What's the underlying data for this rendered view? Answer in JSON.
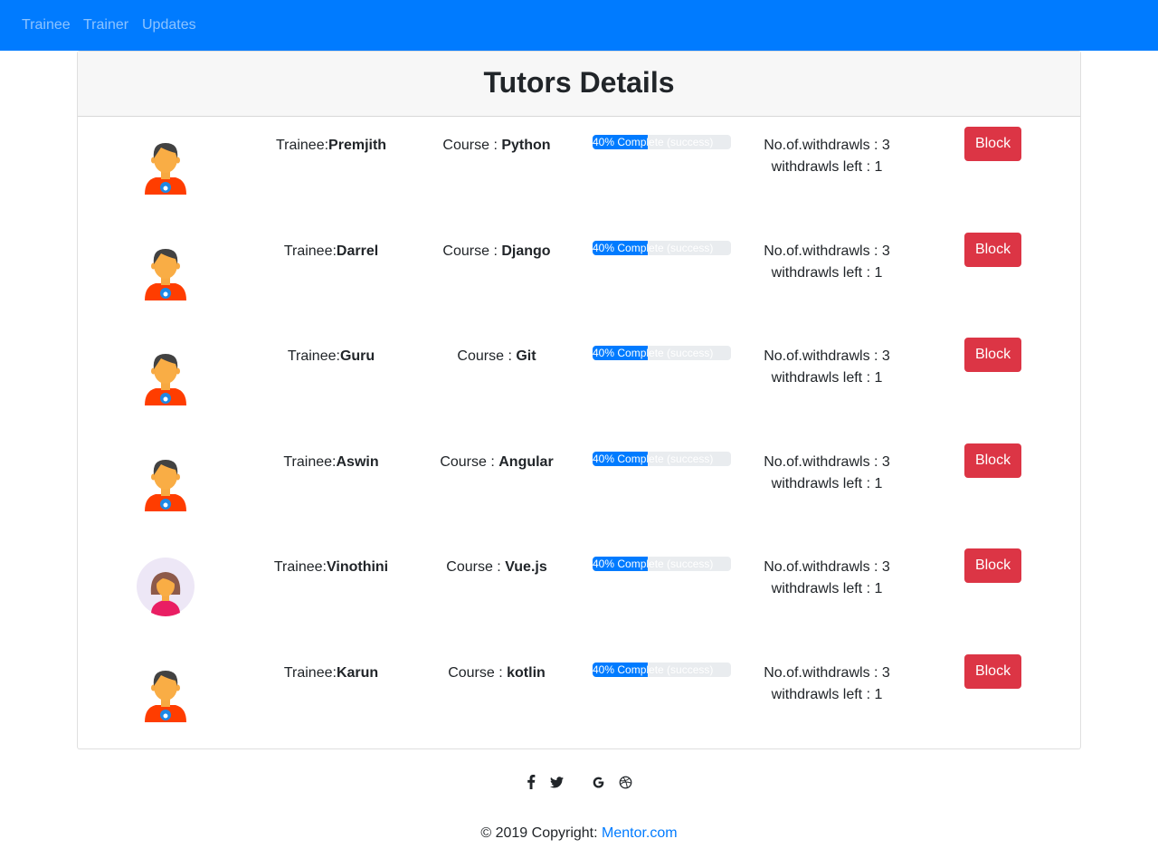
{
  "nav": {
    "items": [
      {
        "label": "Trainee"
      },
      {
        "label": "Trainer"
      },
      {
        "label": "Updates"
      }
    ]
  },
  "page": {
    "title": "Tutors Details"
  },
  "trainee_prefix": "Trainee:",
  "course_prefix": "Course : ",
  "withdrawals_label": "No.of.withdrawls : ",
  "withdrawals_left_label": "withdrawls left : ",
  "block_label": "Block",
  "trainees": [
    {
      "name": "Premjith",
      "course": "Python",
      "progress": 40,
      "progress_text": "40% Complete (success)",
      "withdrawals": "3",
      "withdrawals_left": "1",
      "avatar": "male-avatar-icon"
    },
    {
      "name": "Darrel",
      "course": "Django",
      "progress": 40,
      "progress_text": "40% Complete (success)",
      "withdrawals": "3",
      "withdrawals_left": "1",
      "avatar": "male-avatar-icon"
    },
    {
      "name": "Guru",
      "course": "Git",
      "progress": 40,
      "progress_text": "40% Complete (success)",
      "withdrawals": "3",
      "withdrawals_left": "1",
      "avatar": "male-avatar-icon"
    },
    {
      "name": "Aswin",
      "course": "Angular",
      "progress": 40,
      "progress_text": "40% Complete (success)",
      "withdrawals": "3",
      "withdrawals_left": "1",
      "avatar": "male-avatar-icon"
    },
    {
      "name": "Vinothini",
      "course": "Vue.js",
      "progress": 40,
      "progress_text": "40% Complete (success)",
      "withdrawals": "3",
      "withdrawals_left": "1",
      "avatar": "female-avatar-icon"
    },
    {
      "name": "Karun",
      "course": "kotlin",
      "progress": 40,
      "progress_text": "40% Complete (success)",
      "withdrawals": "3",
      "withdrawals_left": "1",
      "avatar": "male-avatar-icon"
    }
  ],
  "footer": {
    "social_icons": [
      "facebook-icon",
      "twitter-icon",
      "google-icon",
      "dribbble-icon"
    ],
    "copyright_text": "© 2019 Copyright: ",
    "link_text": "Mentor.com"
  },
  "colors": {
    "navbar": "#007bff",
    "progress": "#007bff",
    "block_button": "#dc3545",
    "link": "#007bff"
  }
}
